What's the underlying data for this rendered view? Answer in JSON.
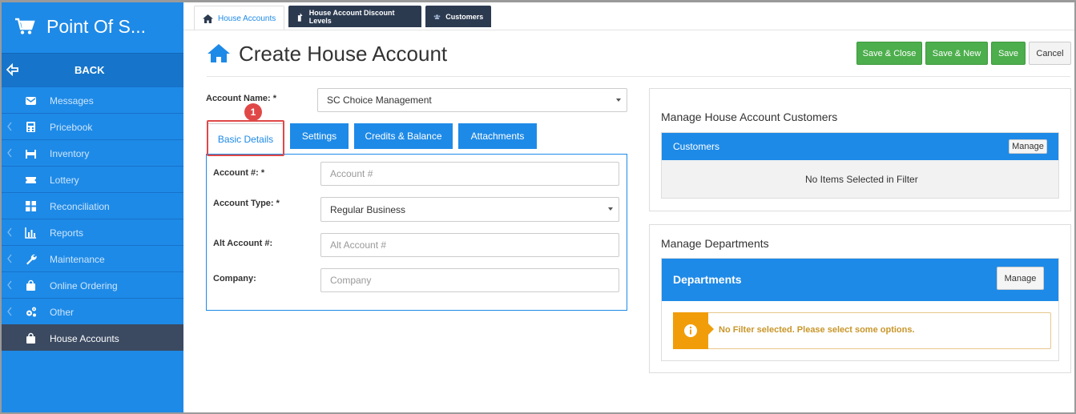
{
  "sidebar": {
    "brand": "Point Of S...",
    "back_label": "BACK",
    "items": [
      {
        "label": "Messages",
        "icon": "envelope-icon",
        "chevron": false
      },
      {
        "label": "Pricebook",
        "icon": "calculator-icon",
        "chevron": true
      },
      {
        "label": "Inventory",
        "icon": "warehouse-icon",
        "chevron": true
      },
      {
        "label": "Lottery",
        "icon": "ticket-icon",
        "chevron": false
      },
      {
        "label": "Reconciliation",
        "icon": "grid-icon",
        "chevron": false
      },
      {
        "label": "Reports",
        "icon": "bar-chart-icon",
        "chevron": true
      },
      {
        "label": "Maintenance",
        "icon": "wrench-icon",
        "chevron": true
      },
      {
        "label": "Online Ordering",
        "icon": "bag-icon",
        "chevron": true
      },
      {
        "label": "Other",
        "icon": "gears-icon",
        "chevron": true
      },
      {
        "label": "House Accounts",
        "icon": "bag-icon",
        "chevron": false,
        "active": true
      }
    ]
  },
  "top_tabs": [
    "House Accounts",
    "House Account Discount Levels",
    "Customers"
  ],
  "header": {
    "title": "Create House Account",
    "save_close": "Save & Close",
    "save_new": "Save & New",
    "save": "Save",
    "cancel": "Cancel"
  },
  "form": {
    "account_name_label": "Account Name: *",
    "account_name_value": "SC Choice Management",
    "tabs": [
      "Basic Details",
      "Settings",
      "Credits & Balance",
      "Attachments"
    ],
    "callout_number": "1",
    "account_no_label": "Account #: *",
    "account_no_placeholder": "Account #",
    "account_type_label": "Account Type: *",
    "account_type_value": "Regular Business",
    "alt_account_label": "Alt Account #:",
    "alt_account_placeholder": "Alt Account #",
    "company_label": "Company:",
    "company_placeholder": "Company"
  },
  "customers_panel": {
    "title": "Manage House Account Customers",
    "bar_label": "Customers",
    "manage_label": "Manage",
    "empty_text": "No Items Selected in Filter"
  },
  "departments_panel": {
    "title": "Manage Departments",
    "bar_label": "Departments",
    "manage_label": "Manage",
    "warning_text": "No Filter selected. Please select some options."
  },
  "colors": {
    "primary": "#1e8ae7",
    "sidebar_active": "#3b4a61",
    "green": "#4cae4c",
    "warning": "#f19d0a",
    "callout": "#e04848"
  }
}
